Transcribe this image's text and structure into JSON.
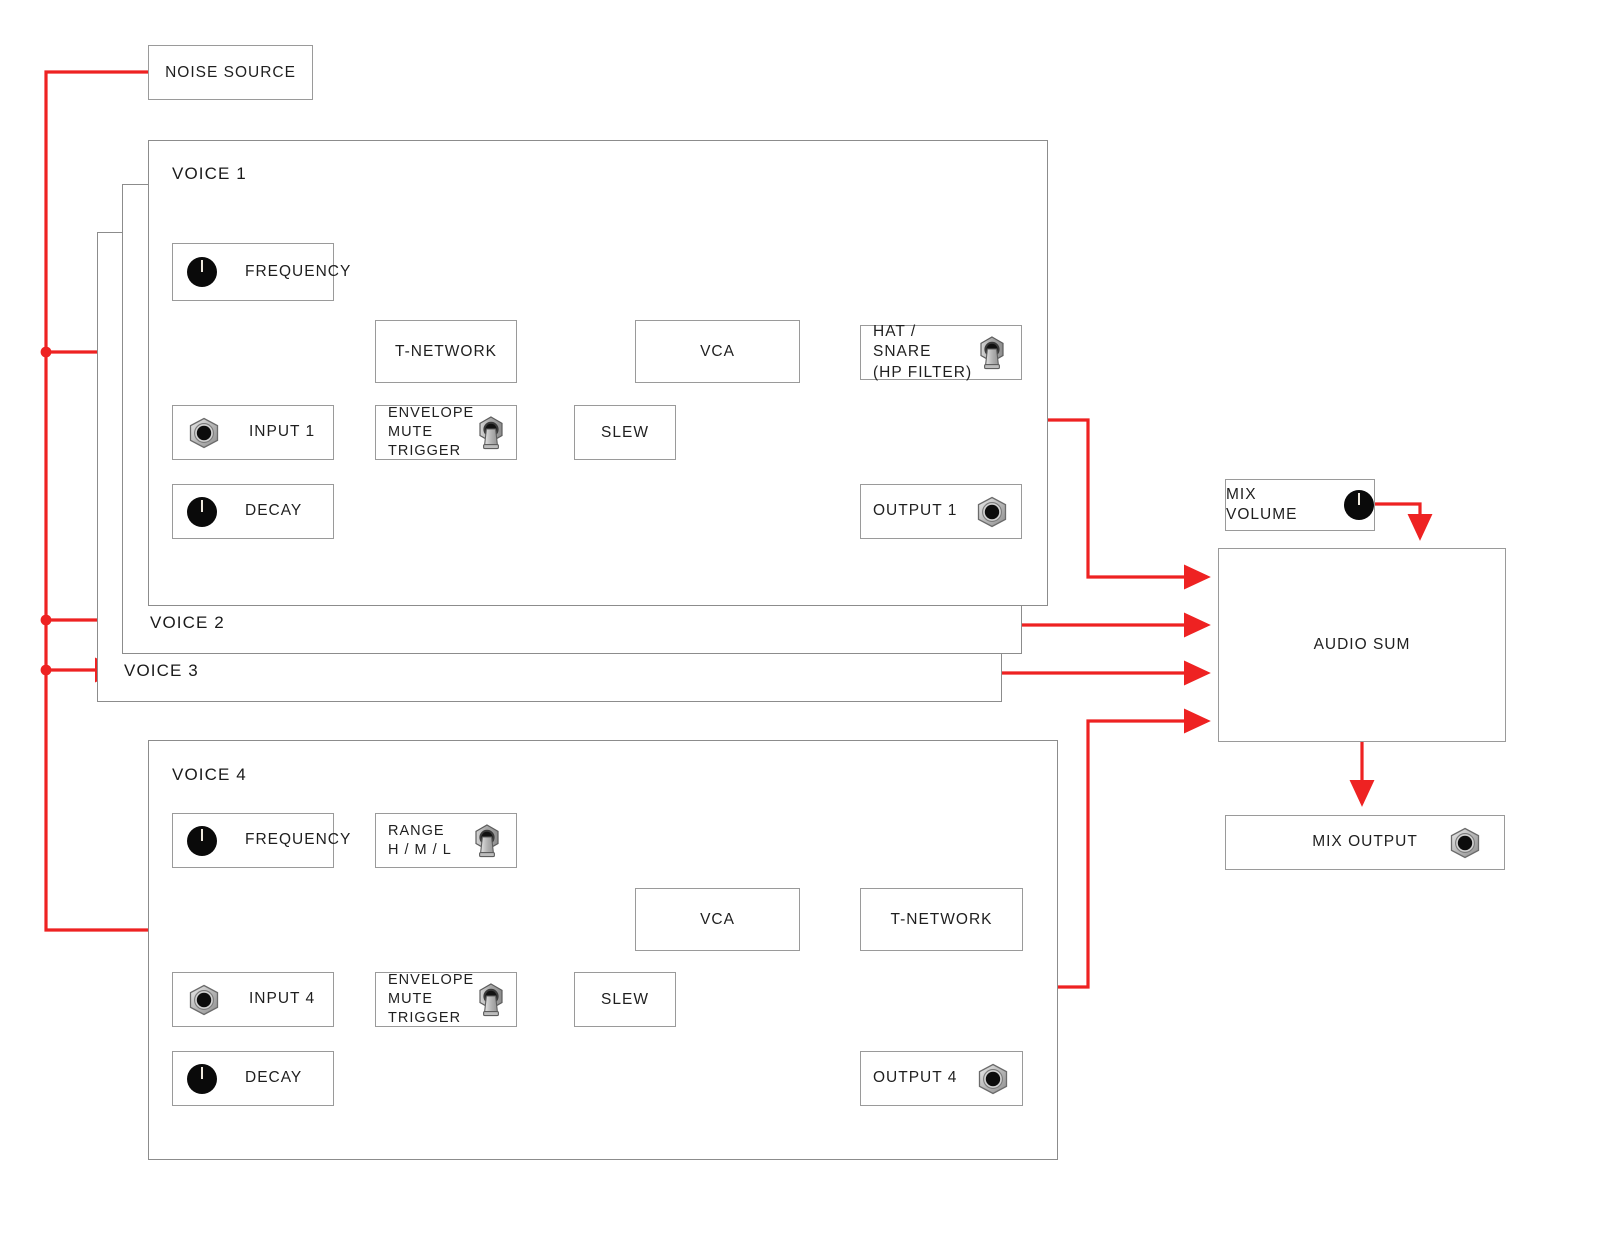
{
  "diagram": {
    "title": "Four voice drum synthesizer signal flow",
    "accent_color": "#ee2222",
    "outline_color": "#9a9a9a",
    "panel_outline_color": "#8c8c8c"
  },
  "noise_source": {
    "label": "NOISE SOURCE"
  },
  "voices": [
    {
      "title": "VOICE 1",
      "frequency": {
        "label": "FREQUENCY",
        "widget": "knob"
      },
      "t_network": {
        "label": "T-NETWORK"
      },
      "vca": {
        "label": "VCA"
      },
      "filter": {
        "label": "HAT / SNARE\n(HP FILTER)",
        "widget": "toggle"
      },
      "input": {
        "label": "INPUT 1",
        "widget": "jack"
      },
      "envelope": {
        "label": "ENVELOPE\nMUTE\nTRIGGER",
        "widget": "toggle"
      },
      "slew": {
        "label": "SLEW"
      },
      "decay": {
        "label": "DECAY",
        "widget": "knob"
      },
      "output": {
        "label": "OUTPUT 1",
        "widget": "jack"
      }
    },
    {
      "title": "VOICE 2"
    },
    {
      "title": "VOICE 3"
    },
    {
      "title": "VOICE 4",
      "frequency": {
        "label": "FREQUENCY",
        "widget": "knob"
      },
      "range": {
        "label": "RANGE\nH / M / L",
        "widget": "toggle"
      },
      "vca": {
        "label": "VCA"
      },
      "t_network": {
        "label": "T-NETWORK"
      },
      "input": {
        "label": "INPUT 4",
        "widget": "jack"
      },
      "envelope": {
        "label": "ENVELOPE\nMUTE\nTRIGGER",
        "widget": "toggle"
      },
      "slew": {
        "label": "SLEW"
      },
      "decay": {
        "label": "DECAY",
        "widget": "knob"
      },
      "output": {
        "label": "OUTPUT 4",
        "widget": "jack"
      }
    }
  ],
  "mix": {
    "volume": {
      "label": "MIX VOLUME",
      "widget": "knob"
    },
    "sum": {
      "label": "AUDIO SUM"
    },
    "output": {
      "label": "MIX OUTPUT",
      "widget": "jack"
    }
  }
}
